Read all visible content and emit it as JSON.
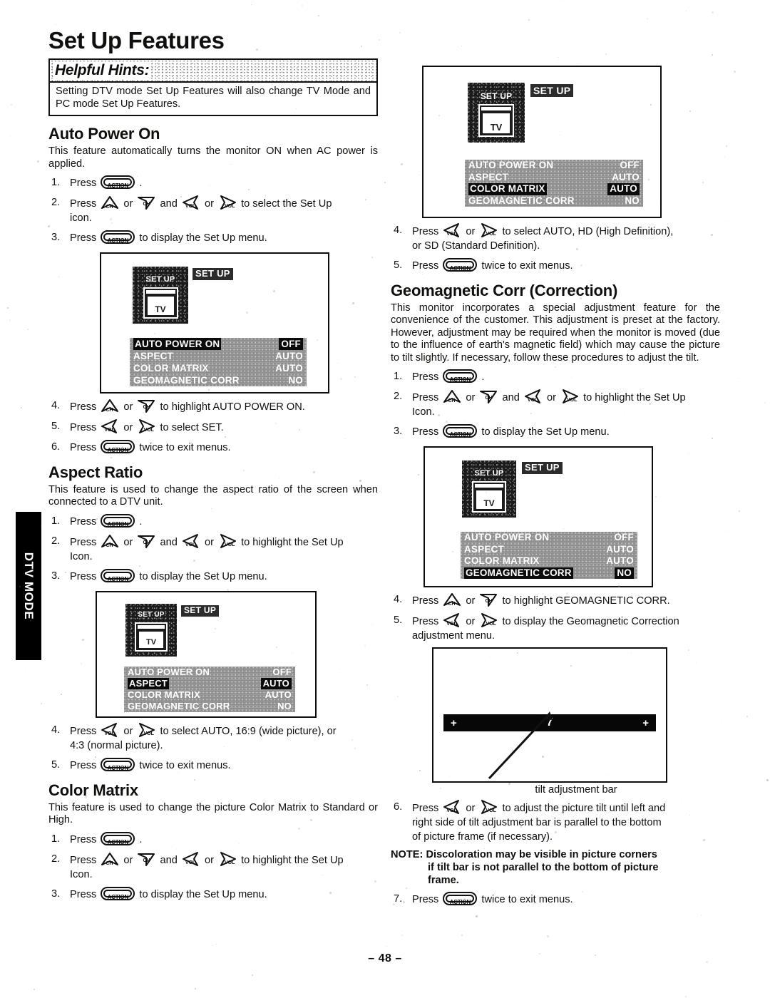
{
  "page": {
    "title": "Set Up Features",
    "page_number": "– 48 –",
    "side_tab": "DTV MODE"
  },
  "hints": {
    "heading": "Helpful Hints:",
    "text": "Setting DTV mode Set Up Features will also change TV Mode and PC mode Set Up Features."
  },
  "keys": {
    "action": "ACTION",
    "ch_up": "CH",
    "ch_down": "CH",
    "vol_left": "VOL",
    "vol_right": "VOL"
  },
  "osd": {
    "icon_label": "SET UP",
    "tv_label": "TV",
    "title": "SET UP",
    "rows": [
      {
        "label": "AUTO POWER ON",
        "value": "OFF"
      },
      {
        "label": "ASPECT",
        "value": "AUTO"
      },
      {
        "label": "COLOR MATRIX",
        "value": "AUTO"
      },
      {
        "label": "GEOMAGNETIC CORR",
        "value": "NO"
      }
    ]
  },
  "sections": [
    {
      "id": "auto-power-on",
      "heading": "Auto Power On",
      "body": "This feature automatically turns the monitor ON when AC power is applied.",
      "steps_before": [
        {
          "num": "1.",
          "pre": "Press",
          "keys": [
            "action"
          ],
          "post": "."
        },
        {
          "num": "2.",
          "pre": "Press",
          "keys": [
            "ch_up",
            "or",
            "ch_down",
            "and",
            "vol_left",
            "or",
            "vol_right"
          ],
          "post": "to select the Set Up",
          "line2": "icon."
        },
        {
          "num": "3.",
          "pre": "Press",
          "keys": [
            "action"
          ],
          "post": "to display the Set Up menu."
        }
      ],
      "highlight_row": 0,
      "highlight_mode": "label",
      "steps_after": [
        {
          "num": "4.",
          "pre": "Press",
          "keys": [
            "ch_up",
            "or",
            "ch_down"
          ],
          "post": "to highlight AUTO POWER ON."
        },
        {
          "num": "5.",
          "pre": "Press",
          "keys": [
            "vol_left",
            "or",
            "vol_right"
          ],
          "post": "to select SET."
        },
        {
          "num": "6.",
          "pre": "Press",
          "keys": [
            "action"
          ],
          "post": "twice to exit menus."
        }
      ]
    },
    {
      "id": "aspect-ratio",
      "heading": "Aspect Ratio",
      "body": "This feature is used to change the aspect ratio of the screen when connected to a DTV unit.",
      "steps_before": [
        {
          "num": "1.",
          "pre": "Press",
          "keys": [
            "action"
          ],
          "post": "."
        },
        {
          "num": "2.",
          "pre": "Press",
          "keys": [
            "ch_up",
            "or",
            "ch_down",
            "and",
            "vol_left",
            "or",
            "vol_right"
          ],
          "post": "to highlight the Set Up",
          "line2": "Icon."
        },
        {
          "num": "3.",
          "pre": "Press",
          "keys": [
            "action"
          ],
          "post": "to display the Set Up menu."
        }
      ],
      "highlight_row": 1,
      "highlight_mode": "both",
      "steps_after": [
        {
          "num": "4.",
          "pre": "Press",
          "keys": [
            "vol_left",
            "or",
            "vol_right"
          ],
          "post": "to select AUTO, 16:9 (wide picture), or",
          "line2": "4:3 (normal picture)."
        },
        {
          "num": "5.",
          "pre": "Press",
          "keys": [
            "action"
          ],
          "post": "twice to exit menus."
        }
      ]
    },
    {
      "id": "color-matrix",
      "heading": "Color Matrix",
      "body": "This feature is used to change the picture Color Matrix to Standard or High.",
      "steps_before": [
        {
          "num": "1.",
          "pre": "Press",
          "keys": [
            "action"
          ],
          "post": "."
        },
        {
          "num": "2.",
          "pre": "Press",
          "keys": [
            "ch_up",
            "or",
            "ch_down",
            "and",
            "vol_left",
            "or",
            "vol_right"
          ],
          "post": "to highlight the Set Up",
          "line2": "Icon."
        },
        {
          "num": "3.",
          "pre": "Press",
          "keys": [
            "action"
          ],
          "post": "to display the Set Up menu."
        }
      ],
      "highlight_row": 2,
      "highlight_mode": "both",
      "steps_after": [
        {
          "num": "4.",
          "pre": "Press",
          "keys": [
            "vol_left",
            "or",
            "vol_right"
          ],
          "post": "to select AUTO, HD (High Definition),",
          "line2": "or SD (Standard Definition)."
        },
        {
          "num": "5.",
          "pre": "Press",
          "keys": [
            "action"
          ],
          "post": "twice to exit menus."
        }
      ]
    },
    {
      "id": "geomagnetic-corr",
      "heading": "Geomagnetic Corr (Correction)",
      "body": "This monitor incorporates a special adjustment feature for the convenience of the customer. This adjustment is preset at the factory. However, adjustment may be required when the monitor is moved (due to the influence of earth's magnetic field) which may cause the picture to tilt slightly. If necessary, follow these procedures to adjust the tilt.",
      "steps_before": [
        {
          "num": "1.",
          "pre": "Press",
          "keys": [
            "action"
          ],
          "post": "."
        },
        {
          "num": "2.",
          "pre": "Press",
          "keys": [
            "ch_up",
            "or",
            "ch_down",
            "and",
            "vol_left",
            "or",
            "vol_right"
          ],
          "post": "to highlight the Set Up",
          "line2": "Icon."
        },
        {
          "num": "3.",
          "pre": "Press",
          "keys": [
            "action"
          ],
          "post": "to display the Set Up menu."
        }
      ],
      "highlight_row": 3,
      "highlight_mode": "both",
      "steps_mid": [
        {
          "num": "4.",
          "pre": "Press",
          "keys": [
            "ch_up",
            "or",
            "ch_down"
          ],
          "post": "to highlight GEOMAGNETIC CORR."
        },
        {
          "num": "5.",
          "pre": "Press",
          "keys": [
            "vol_left",
            "or",
            "vol_right"
          ],
          "post": "to display the Geomagnetic Correction",
          "line2": "adjustment menu."
        }
      ],
      "steps_after": [
        {
          "num": "6.",
          "pre": "Press",
          "keys": [
            "vol_left",
            "or",
            "vol_right"
          ],
          "post": "to  adjust the picture tilt until left and",
          "line2": "right side of tilt adjustment bar is parallel to the bottom",
          "line3": "of picture frame (if necessary)."
        },
        {
          "num": "7.",
          "pre": "Press",
          "keys": [
            "action"
          ],
          "post": "twice to exit menus."
        }
      ],
      "note": {
        "prefix": "NOTE:",
        "line1": "Discoloration may be visible in picture corners",
        "line2": "if tilt bar is not parallel to the bottom of picture",
        "line3": "frame."
      }
    }
  ],
  "tilt_figure": {
    "left_plus": "+",
    "right_plus": "+",
    "value": "7",
    "caption": "tilt adjustment bar"
  }
}
